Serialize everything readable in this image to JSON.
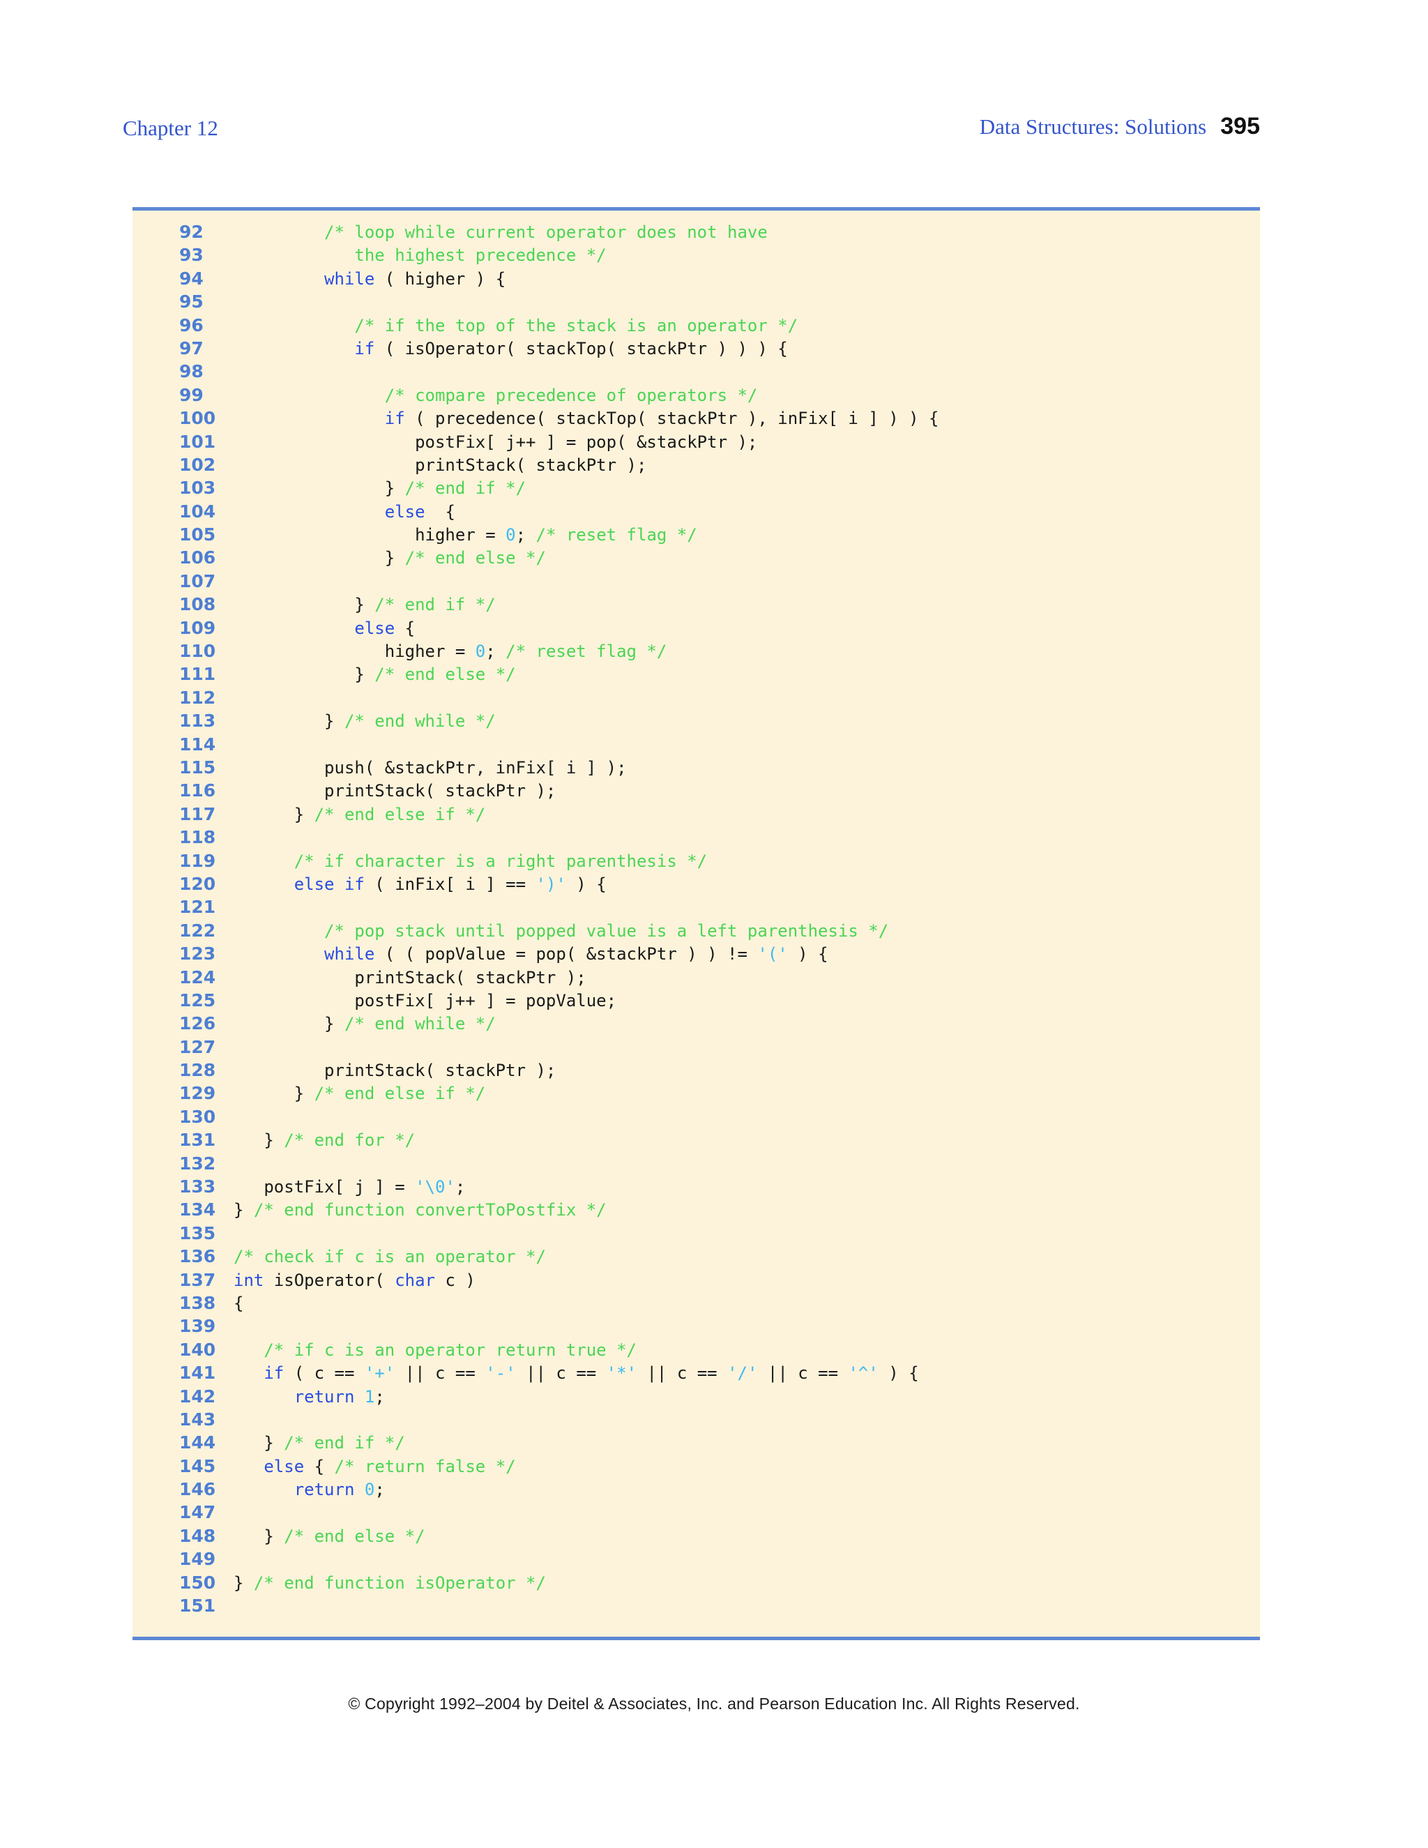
{
  "header": {
    "chapter": "Chapter 12",
    "section_title": "Data Structures: Solutions",
    "page_number": "395"
  },
  "footer": {
    "copyright": "© Copyright 1992–2004 by Deitel & Associates, Inc. and Pearson Education Inc. All Rights Reserved."
  },
  "colors": {
    "page_background": "#ffffff",
    "code_background": "#fcf3da",
    "rule_blue": "#5c88d5",
    "line_number_blue": "#4d7ed3",
    "keyword_blue": "#2a4de0",
    "comment_green": "#4cd455",
    "literal_cyan": "#3eb9f0",
    "code_text": "#191919",
    "header_blue": "#3355cb"
  },
  "code_listing": {
    "language": "C",
    "lines": [
      {
        "n": "92",
        "s": [
          [
            "p",
            "         "
          ],
          [
            "c",
            "/* loop while current operator does not have"
          ]
        ]
      },
      {
        "n": "93",
        "s": [
          [
            "p",
            "            "
          ],
          [
            "c",
            "the highest precedence */"
          ]
        ]
      },
      {
        "n": "94",
        "s": [
          [
            "p",
            "         "
          ],
          [
            "k",
            "while"
          ],
          [
            "p",
            " ( higher ) {"
          ]
        ]
      },
      {
        "n": "95",
        "s": []
      },
      {
        "n": "96",
        "s": [
          [
            "p",
            "            "
          ],
          [
            "c",
            "/* if the top of the stack is an operator */"
          ]
        ]
      },
      {
        "n": "97",
        "s": [
          [
            "p",
            "            "
          ],
          [
            "k",
            "if"
          ],
          [
            "p",
            " ( isOperator( stackTop( stackPtr ) ) ) {"
          ]
        ]
      },
      {
        "n": "98",
        "s": []
      },
      {
        "n": "99",
        "s": [
          [
            "p",
            "               "
          ],
          [
            "c",
            "/* compare precedence of operators */"
          ]
        ]
      },
      {
        "n": "100",
        "s": [
          [
            "p",
            "               "
          ],
          [
            "k",
            "if"
          ],
          [
            "p",
            " ( precedence( stackTop( stackPtr ), inFix[ i ] ) ) {"
          ]
        ]
      },
      {
        "n": "101",
        "s": [
          [
            "p",
            "                  postFix[ j++ ] = pop( &stackPtr );"
          ]
        ]
      },
      {
        "n": "102",
        "s": [
          [
            "p",
            "                  printStack( stackPtr );"
          ]
        ]
      },
      {
        "n": "103",
        "s": [
          [
            "p",
            "               } "
          ],
          [
            "c",
            "/* end if */"
          ]
        ]
      },
      {
        "n": "104",
        "s": [
          [
            "p",
            "               "
          ],
          [
            "k",
            "else"
          ],
          [
            "p",
            "  {"
          ]
        ]
      },
      {
        "n": "105",
        "s": [
          [
            "p",
            "                  higher = "
          ],
          [
            "l",
            "0"
          ],
          [
            "p",
            "; "
          ],
          [
            "c",
            "/* reset flag */"
          ]
        ]
      },
      {
        "n": "106",
        "s": [
          [
            "p",
            "               } "
          ],
          [
            "c",
            "/* end else */"
          ]
        ]
      },
      {
        "n": "107",
        "s": []
      },
      {
        "n": "108",
        "s": [
          [
            "p",
            "            } "
          ],
          [
            "c",
            "/* end if */"
          ]
        ]
      },
      {
        "n": "109",
        "s": [
          [
            "p",
            "            "
          ],
          [
            "k",
            "else"
          ],
          [
            "p",
            " {"
          ]
        ]
      },
      {
        "n": "110",
        "s": [
          [
            "p",
            "               higher = "
          ],
          [
            "l",
            "0"
          ],
          [
            "p",
            "; "
          ],
          [
            "c",
            "/* reset flag */"
          ]
        ]
      },
      {
        "n": "111",
        "s": [
          [
            "p",
            "            } "
          ],
          [
            "c",
            "/* end else */"
          ]
        ]
      },
      {
        "n": "112",
        "s": []
      },
      {
        "n": "113",
        "s": [
          [
            "p",
            "         } "
          ],
          [
            "c",
            "/* end while */"
          ]
        ]
      },
      {
        "n": "114",
        "s": []
      },
      {
        "n": "115",
        "s": [
          [
            "p",
            "         push( &stackPtr, inFix[ i ] );"
          ]
        ]
      },
      {
        "n": "116",
        "s": [
          [
            "p",
            "         printStack( stackPtr );"
          ]
        ]
      },
      {
        "n": "117",
        "s": [
          [
            "p",
            "      } "
          ],
          [
            "c",
            "/* end else if */"
          ]
        ]
      },
      {
        "n": "118",
        "s": []
      },
      {
        "n": "119",
        "s": [
          [
            "p",
            "      "
          ],
          [
            "c",
            "/* if character is a right parenthesis */"
          ]
        ]
      },
      {
        "n": "120",
        "s": [
          [
            "p",
            "      "
          ],
          [
            "k",
            "else"
          ],
          [
            "p",
            " "
          ],
          [
            "k",
            "if"
          ],
          [
            "p",
            " ( inFix[ i ] == "
          ],
          [
            "l",
            "')'"
          ],
          [
            "p",
            " ) {"
          ]
        ]
      },
      {
        "n": "121",
        "s": []
      },
      {
        "n": "122",
        "s": [
          [
            "p",
            "         "
          ],
          [
            "c",
            "/* pop stack until popped value is a left parenthesis */"
          ]
        ]
      },
      {
        "n": "123",
        "s": [
          [
            "p",
            "         "
          ],
          [
            "k",
            "while"
          ],
          [
            "p",
            " ( ( popValue = pop( &stackPtr ) ) != "
          ],
          [
            "l",
            "'('"
          ],
          [
            "p",
            " ) {"
          ]
        ]
      },
      {
        "n": "124",
        "s": [
          [
            "p",
            "            printStack( stackPtr );"
          ]
        ]
      },
      {
        "n": "125",
        "s": [
          [
            "p",
            "            postFix[ j++ ] = popValue;"
          ]
        ]
      },
      {
        "n": "126",
        "s": [
          [
            "p",
            "         } "
          ],
          [
            "c",
            "/* end while */"
          ]
        ]
      },
      {
        "n": "127",
        "s": []
      },
      {
        "n": "128",
        "s": [
          [
            "p",
            "         printStack( stackPtr );"
          ]
        ]
      },
      {
        "n": "129",
        "s": [
          [
            "p",
            "      } "
          ],
          [
            "c",
            "/* end else if */"
          ]
        ]
      },
      {
        "n": "130",
        "s": []
      },
      {
        "n": "131",
        "s": [
          [
            "p",
            "   } "
          ],
          [
            "c",
            "/* end for */"
          ]
        ]
      },
      {
        "n": "132",
        "s": []
      },
      {
        "n": "133",
        "s": [
          [
            "p",
            "   postFix[ j ] = "
          ],
          [
            "l",
            "'\\0'"
          ],
          [
            "p",
            ";"
          ]
        ]
      },
      {
        "n": "134",
        "s": [
          [
            "p",
            "} "
          ],
          [
            "c",
            "/* end function convertToPostfix */"
          ]
        ]
      },
      {
        "n": "135",
        "s": []
      },
      {
        "n": "136",
        "s": [
          [
            "c",
            "/* check if c is an operator */"
          ]
        ]
      },
      {
        "n": "137",
        "s": [
          [
            "k",
            "int"
          ],
          [
            "p",
            " isOperator( "
          ],
          [
            "k",
            "char"
          ],
          [
            "p",
            " c )"
          ]
        ]
      },
      {
        "n": "138",
        "s": [
          [
            "p",
            "{"
          ]
        ]
      },
      {
        "n": "139",
        "s": []
      },
      {
        "n": "140",
        "s": [
          [
            "p",
            "   "
          ],
          [
            "c",
            "/* if c is an operator return true */"
          ]
        ]
      },
      {
        "n": "141",
        "s": [
          [
            "p",
            "   "
          ],
          [
            "k",
            "if"
          ],
          [
            "p",
            " ( c == "
          ],
          [
            "l",
            "'+'"
          ],
          [
            "p",
            " || c == "
          ],
          [
            "l",
            "'-'"
          ],
          [
            "p",
            " || c == "
          ],
          [
            "l",
            "'*'"
          ],
          [
            "p",
            " || c == "
          ],
          [
            "l",
            "'/'"
          ],
          [
            "p",
            " || c == "
          ],
          [
            "l",
            "'^'"
          ],
          [
            "p",
            " ) {"
          ]
        ]
      },
      {
        "n": "142",
        "s": [
          [
            "p",
            "      "
          ],
          [
            "k",
            "return"
          ],
          [
            "p",
            " "
          ],
          [
            "l",
            "1"
          ],
          [
            "p",
            ";"
          ]
        ]
      },
      {
        "n": "143",
        "s": []
      },
      {
        "n": "144",
        "s": [
          [
            "p",
            "   } "
          ],
          [
            "c",
            "/* end if */"
          ]
        ]
      },
      {
        "n": "145",
        "s": [
          [
            "p",
            "   "
          ],
          [
            "k",
            "else"
          ],
          [
            "p",
            " { "
          ],
          [
            "c",
            "/* return false */"
          ]
        ]
      },
      {
        "n": "146",
        "s": [
          [
            "p",
            "      "
          ],
          [
            "k",
            "return"
          ],
          [
            "p",
            " "
          ],
          [
            "l",
            "0"
          ],
          [
            "p",
            ";"
          ]
        ]
      },
      {
        "n": "147",
        "s": []
      },
      {
        "n": "148",
        "s": [
          [
            "p",
            "   } "
          ],
          [
            "c",
            "/* end else */"
          ]
        ]
      },
      {
        "n": "149",
        "s": []
      },
      {
        "n": "150",
        "s": [
          [
            "p",
            "} "
          ],
          [
            "c",
            "/* end function isOperator */"
          ]
        ]
      },
      {
        "n": "151",
        "s": []
      }
    ]
  }
}
